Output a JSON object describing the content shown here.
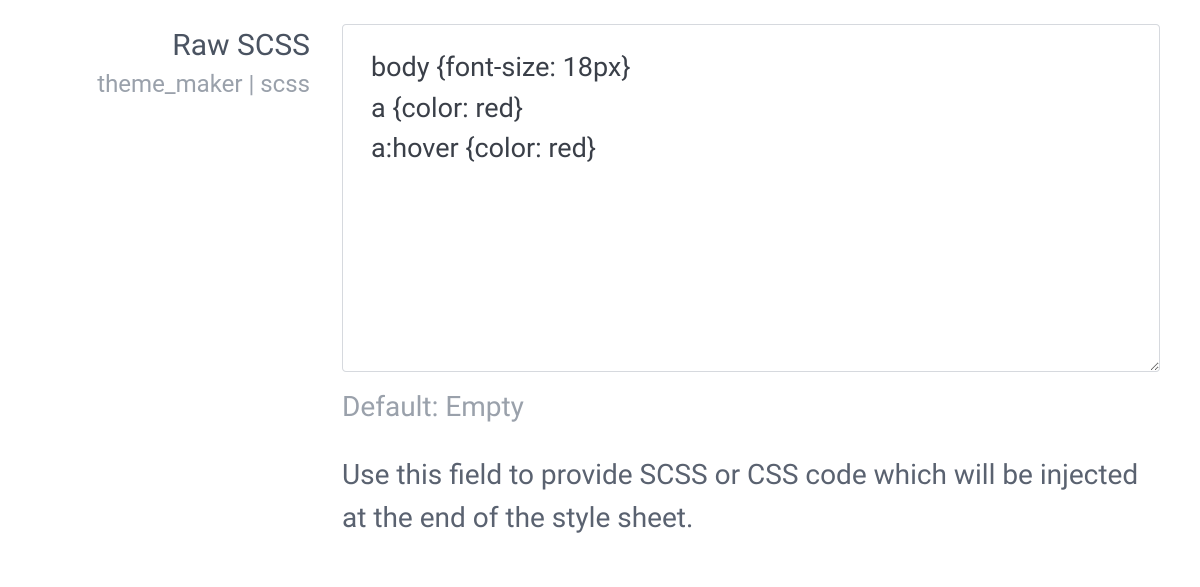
{
  "field": {
    "label": "Raw SCSS",
    "sublabel": "theme_maker | scss",
    "value": "body {font-size: 18px}\na {color: red}\na:hover {color: red}",
    "default_text": "Default: Empty",
    "help_text": "Use this field to provide SCSS or CSS code which will be injected at the end of the style sheet."
  }
}
